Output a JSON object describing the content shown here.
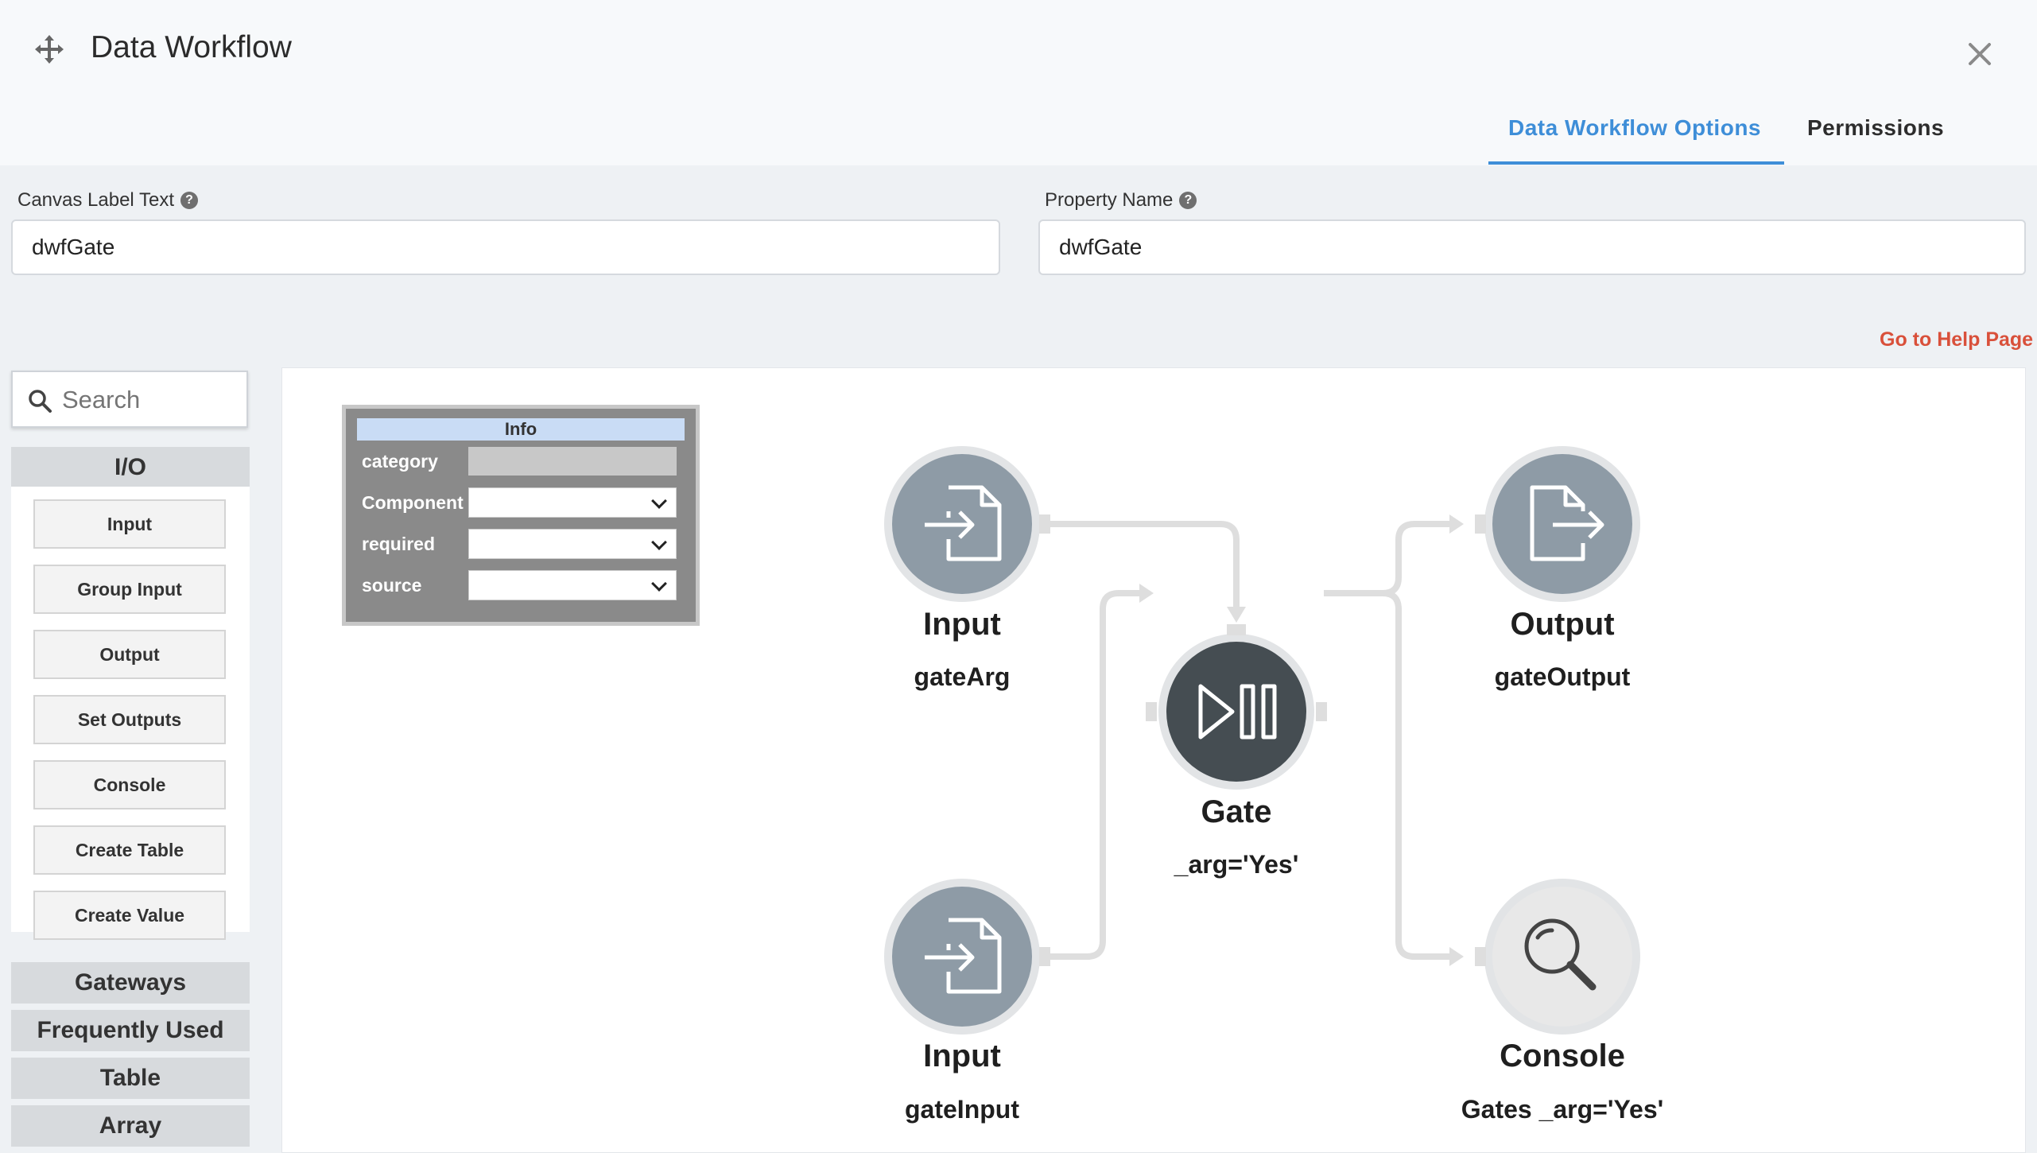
{
  "header": {
    "title": "Data Workflow",
    "tabs": [
      {
        "label": "Data Workflow Options",
        "active": true
      },
      {
        "label": "Permissions",
        "active": false
      }
    ]
  },
  "form": {
    "canvas_label": {
      "label": "Canvas Label Text",
      "value": "dwfGate"
    },
    "property_name": {
      "label": "Property Name",
      "value": "dwfGate"
    },
    "help_link": "Go to Help Page"
  },
  "palette": {
    "search_placeholder": "Search",
    "groups": [
      {
        "label": "I/O",
        "expanded": true,
        "items": [
          "Input",
          "Group Input",
          "Output",
          "Set Outputs",
          "Console",
          "Create Table",
          "Create Value"
        ]
      },
      {
        "label": "Gateways",
        "expanded": false
      },
      {
        "label": "Frequently Used",
        "expanded": false
      },
      {
        "label": "Table",
        "expanded": false
      },
      {
        "label": "Array",
        "expanded": false
      }
    ]
  },
  "info_panel": {
    "title": "Info",
    "rows": [
      {
        "key": "category",
        "type": "readonly"
      },
      {
        "key": "Component",
        "type": "select"
      },
      {
        "key": "required",
        "type": "select"
      },
      {
        "key": "source",
        "type": "select"
      }
    ]
  },
  "nodes": {
    "input1": {
      "label": "Input",
      "sublabel": "gateArg",
      "icon": "file-import-icon"
    },
    "input2": {
      "label": "Input",
      "sublabel": "gateInput",
      "icon": "file-import-icon"
    },
    "gate": {
      "label": "Gate",
      "sublabel": "_arg='Yes'",
      "icon": "play-pause-icon"
    },
    "output": {
      "label": "Output",
      "sublabel": "gateOutput",
      "icon": "file-export-icon"
    },
    "console": {
      "label": "Console",
      "sublabel": "Gates _arg='Yes'",
      "icon": "magnifier-icon"
    }
  },
  "colors": {
    "accent": "#3e8ed8",
    "help_link": "#d9503a",
    "node_fill": "#8e9ba6",
    "gate_fill": "#454d52",
    "wire": "#dedede"
  }
}
